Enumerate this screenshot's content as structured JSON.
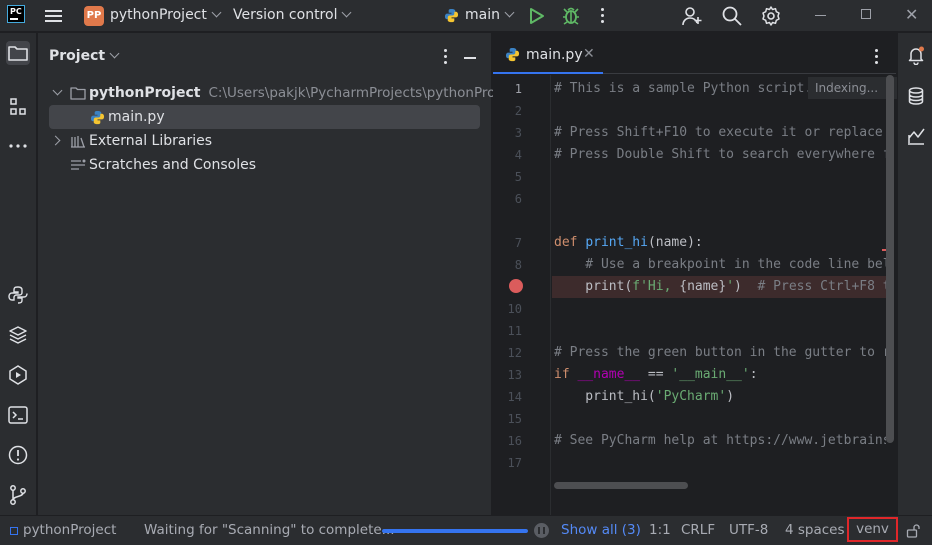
{
  "titlebar": {
    "app_logo": "PC",
    "project_badge": "PP",
    "project_name": "pythonProject",
    "version_control": "Version control",
    "run_config": "main",
    "icons": [
      "hamburger-menu-icon",
      "run-icon",
      "debug-icon",
      "more-vertical-icon",
      "add-user-icon",
      "search-icon",
      "gear-icon",
      "minimize-icon",
      "maximize-icon",
      "close-icon"
    ]
  },
  "left_toolbar": {
    "icons": [
      "project-folder-icon",
      "structure-icon",
      "more-horizontal-icon",
      "python-console-icon",
      "layers-icon",
      "services-icon",
      "terminal-icon",
      "problems-icon",
      "git-icon"
    ]
  },
  "project_panel": {
    "title": "Project",
    "tree": [
      {
        "label": "pythonProject",
        "path": "C:\\Users\\pakjk\\PycharmProjects\\pythonProject",
        "icon": "folder-icon",
        "expanded": true
      },
      {
        "label": "main.py",
        "icon": "python-file-icon",
        "selected": true
      },
      {
        "label": "External Libraries",
        "icon": "library-icon",
        "expanded": false
      },
      {
        "label": "Scratches and Consoles",
        "icon": "scratches-icon"
      }
    ]
  },
  "editor": {
    "tab_label": "main.py",
    "indexing": "Indexing...",
    "line_numbers": [
      "1",
      "2",
      "3",
      "4",
      "5",
      "6",
      "7",
      "8",
      "9",
      "10",
      "11",
      "12",
      "13",
      "14",
      "15",
      "16",
      "17"
    ],
    "breakpoint_line": 9,
    "code": {
      "l1": "# This is a sample Python script.",
      "l3": "# Press Shift+F10 to execute it or replace",
      "l4": "# Press Double Shift to search everywhere f",
      "l7_kw": "def",
      "l7_fn": "print_hi",
      "l7_rest": "(name):",
      "l8": "    # Use a breakpoint in the code line bel",
      "l9_a": "    print(",
      "l9_str": "f'Hi, ",
      "l9_br": "{name}",
      "l9_str2": "'",
      "l9_b": ")",
      "l9_com": "  # Press Ctrl+F8 t",
      "l12": "# Press the green button in the gutter to r",
      "l13_kw": "if",
      "l13_dunder": " __name__",
      "l13_mid": " == ",
      "l13_str": "'__main__'",
      "l13_end": ":",
      "l14_a": "    print_hi(",
      "l14_str": "'PyCharm'",
      "l14_b": ")",
      "l16": "# See PyCharm help at https://www.jetbrains"
    }
  },
  "right_toolbar": {
    "icons": [
      "notifications-icon",
      "database-icon",
      "analytics-icon"
    ]
  },
  "statusbar": {
    "project": "pythonProject",
    "message": "Waiting for \"Scanning\" to complete...",
    "progress": 1.0,
    "show_all": "Show all (3)",
    "position": "1:1",
    "line_sep": "CRLF",
    "encoding": "UTF-8",
    "indent": "4 spaces",
    "interpreter": "venv"
  },
  "colors": {
    "accent": "#3574f0",
    "highlight_box": "#e0272a",
    "run_green": "#5fb865",
    "breakpoint": "#db5c5c"
  }
}
